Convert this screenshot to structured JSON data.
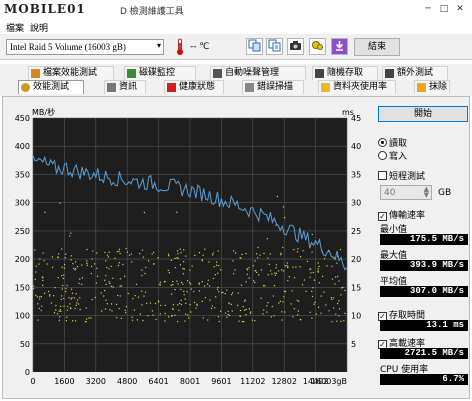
{
  "window": {
    "logo": "MOBILE01",
    "title": "D 檢測維護工具",
    "controls": [
      "─",
      "□",
      "✕"
    ]
  },
  "menu": [
    "檔案",
    "說明"
  ],
  "toolbar": {
    "drive": "Intel  Raid 5 Volume (16003 gB)",
    "temperature": "-- ℃",
    "exit_label": "結束",
    "icons": [
      "copy-icon",
      "copy-text-icon",
      "camera-icon",
      "settings-icon",
      "download-icon"
    ]
  },
  "tabs_row1": [
    "檔案效能測試",
    "磁碟監控",
    "自動噪聲管理",
    "隨機存取",
    "額外測試"
  ],
  "tabs_row2": [
    "效能測試",
    "資訊",
    "健康狀態",
    "錯誤掃描",
    "資料夾使用率",
    "抹除"
  ],
  "side": {
    "start_label": "開始",
    "read_label": "讀取",
    "write_label": "寫入",
    "short_test_label": "短程測試",
    "short_test_value": "40",
    "short_test_unit": "GB",
    "transfer_label": "傳輸速率",
    "min_label": "最小值",
    "min_value": "175.5 MB/s",
    "max_label": "最大值",
    "max_value": "393.9 MB/s",
    "avg_label": "平均值",
    "avg_value": "307.0 MB/s",
    "access_label": "存取時間",
    "access_value": "13.1 ms",
    "burst_label": "高載速率",
    "burst_value": "2721.5 MB/s",
    "cpu_label": "CPU 使用率",
    "cpu_value": "6.7%"
  },
  "chart_data": {
    "type": "line",
    "ylabel": "MB/秒",
    "y2label": "ms",
    "ylim": [
      0,
      450
    ],
    "y2lim": [
      0,
      45
    ],
    "yticks": [
      50,
      100,
      150,
      200,
      250,
      300,
      350,
      400,
      450
    ],
    "y2ticks": [
      5,
      10,
      15,
      20,
      25,
      30,
      35,
      40,
      45
    ],
    "xticks": [
      "0",
      "1600",
      "3200",
      "4800",
      "6401",
      "8001",
      "9601",
      "11202",
      "12802",
      "14402",
      "16003gB"
    ],
    "xlim": [
      0,
      16003
    ],
    "grid": true,
    "transfer_color": "#5aa0d8",
    "access_color": "#d8d84a",
    "transfer": [
      [
        0,
        370
      ],
      [
        400,
        372
      ],
      [
        800,
        365
      ],
      [
        1200,
        360
      ],
      [
        1600,
        362
      ],
      [
        2000,
        358
      ],
      [
        2400,
        355
      ],
      [
        2800,
        352
      ],
      [
        3200,
        350
      ],
      [
        3600,
        346
      ],
      [
        4000,
        345
      ],
      [
        4400,
        342
      ],
      [
        4800,
        340
      ],
      [
        5200,
        338
      ],
      [
        5600,
        336
      ],
      [
        6000,
        335
      ],
      [
        6401,
        332
      ],
      [
        6800,
        330
      ],
      [
        7200,
        328
      ],
      [
        7600,
        325
      ],
      [
        8001,
        322
      ],
      [
        8400,
        318
      ],
      [
        8800,
        315
      ],
      [
        9200,
        310
      ],
      [
        9601,
        305
      ],
      [
        10000,
        300
      ],
      [
        10400,
        296
      ],
      [
        10800,
        290
      ],
      [
        11202,
        285
      ],
      [
        11600,
        280
      ],
      [
        12000,
        272
      ],
      [
        12400,
        265
      ],
      [
        12802,
        258
      ],
      [
        13200,
        250
      ],
      [
        13600,
        242
      ],
      [
        14000,
        235
      ],
      [
        14402,
        228
      ],
      [
        14800,
        220
      ],
      [
        15200,
        212
      ],
      [
        15600,
        200
      ],
      [
        16003,
        185
      ]
    ],
    "access_ms_band": [
      9,
      22
    ]
  }
}
